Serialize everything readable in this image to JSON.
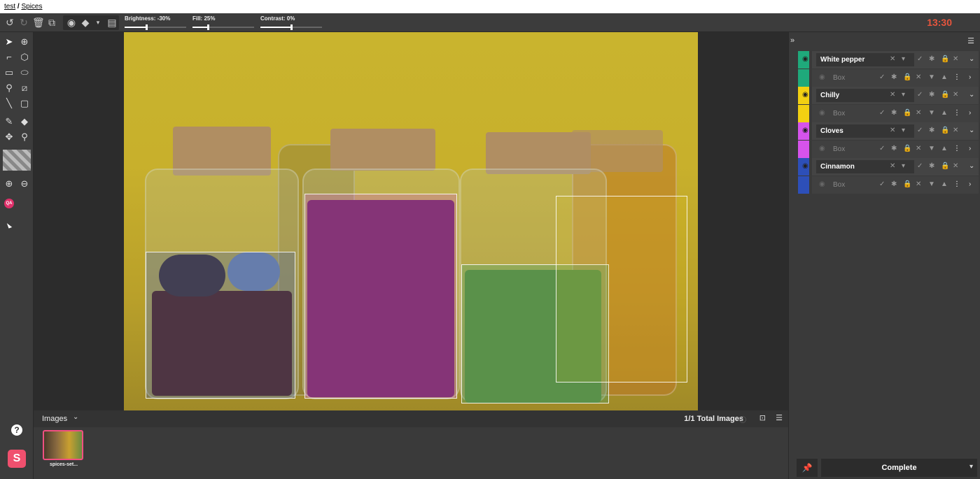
{
  "breadcrumb": {
    "project": "test",
    "dataset": "Spices",
    "separator": "/"
  },
  "toolbar": {
    "sliders": [
      {
        "label": "Brightness: -30%",
        "value": 0.35
      },
      {
        "label": "Fill: 25%",
        "value": 0.25
      },
      {
        "label": "Contrast: 0%",
        "value": 0.5
      }
    ],
    "timer": "13:30"
  },
  "images_panel": {
    "title": "Images",
    "count": "1/1 Total Images",
    "thumb_label": "spices-set..."
  },
  "annotations": [
    {
      "class": "White pepper",
      "color": "#1fa97b",
      "sub": "Box"
    },
    {
      "class": "Chilly",
      "color": "#f2d012",
      "sub": "Box"
    },
    {
      "class": "Cloves",
      "color": "#d653ec",
      "sub": "Box"
    },
    {
      "class": "Cinnamon",
      "color": "#2d4fb8",
      "sub": "Box"
    }
  ],
  "complete_label": "Complete",
  "qa_label": "QA",
  "help_label": "?",
  "logo_label": "S"
}
